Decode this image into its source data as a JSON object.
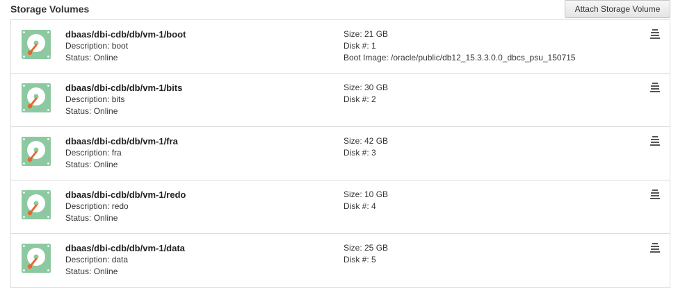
{
  "section": {
    "title": "Storage Volumes",
    "attach_button_label": "Attach Storage Volume"
  },
  "colors": {
    "icon_green": "#8dc9a0",
    "icon_orange": "#e8672d",
    "border": "#dcdcdc"
  },
  "volumes": [
    {
      "name": "dbaas/dbi-cdb/db/vm-1/boot",
      "description": "Description: boot",
      "status": "Status: Online",
      "size": "Size: 21 GB",
      "disk": "Disk #: 1",
      "boot_image": "Boot Image: /oracle/public/db12_15.3.3.0.0_dbcs_psu_150715"
    },
    {
      "name": "dbaas/dbi-cdb/db/vm-1/bits",
      "description": "Description: bits",
      "status": "Status: Online",
      "size": "Size: 30 GB",
      "disk": "Disk #: 2"
    },
    {
      "name": "dbaas/dbi-cdb/db/vm-1/fra",
      "description": "Description: fra",
      "status": "Status: Online",
      "size": "Size: 42 GB",
      "disk": "Disk #: 3"
    },
    {
      "name": "dbaas/dbi-cdb/db/vm-1/redo",
      "description": "Description: redo",
      "status": "Status: Online",
      "size": "Size: 10 GB",
      "disk": "Disk #: 4"
    },
    {
      "name": "dbaas/dbi-cdb/db/vm-1/data",
      "description": "Description: data",
      "status": "Status: Online",
      "size": "Size: 25 GB",
      "disk": "Disk #: 5"
    }
  ]
}
